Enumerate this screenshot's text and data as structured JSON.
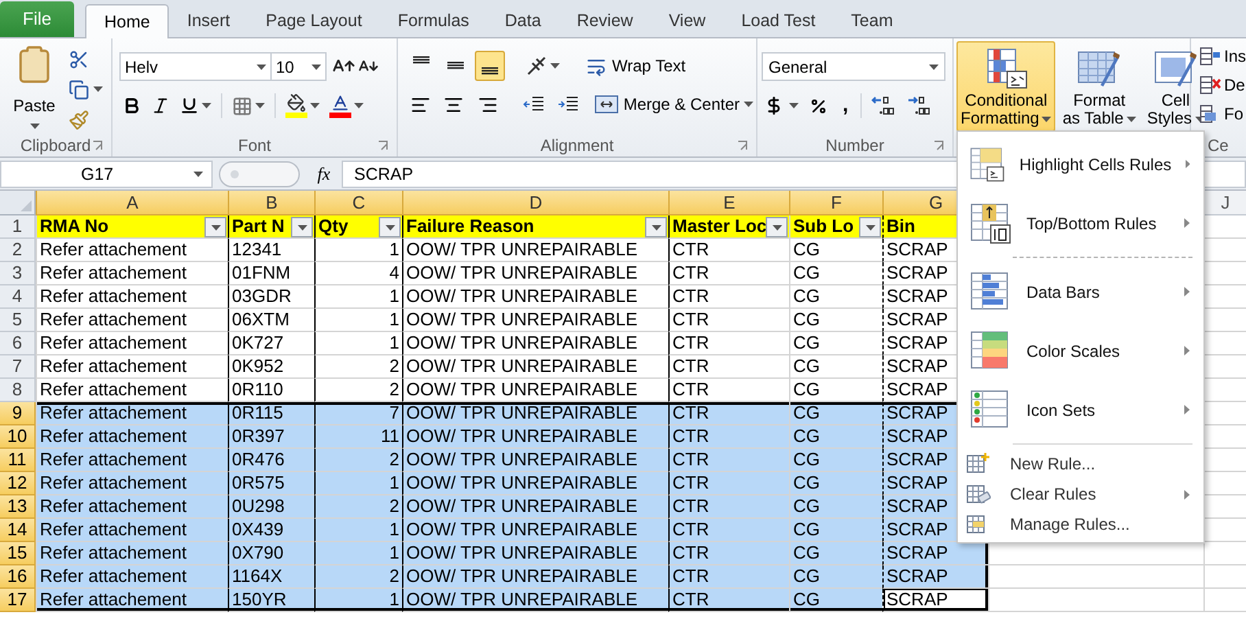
{
  "ribbon_tabs": [
    {
      "label": "File",
      "kind": "file",
      "selected": false
    },
    {
      "label": "Home",
      "kind": "tab",
      "selected": true
    },
    {
      "label": "Insert",
      "kind": "tab",
      "selected": false
    },
    {
      "label": "Page Layout",
      "kind": "tab",
      "selected": false
    },
    {
      "label": "Formulas",
      "kind": "tab",
      "selected": false
    },
    {
      "label": "Data",
      "kind": "tab",
      "selected": false
    },
    {
      "label": "Review",
      "kind": "tab",
      "selected": false
    },
    {
      "label": "View",
      "kind": "tab",
      "selected": false
    },
    {
      "label": "Load Test",
      "kind": "tab",
      "selected": false
    },
    {
      "label": "Team",
      "kind": "tab",
      "selected": false
    }
  ],
  "clipboard": {
    "paste": "Paste",
    "label": "Clipboard"
  },
  "font": {
    "name": "Helv",
    "size": "10",
    "label": "Font"
  },
  "alignment": {
    "vertical": [
      {
        "selected": false
      },
      {
        "selected": false
      },
      {
        "selected": true
      }
    ],
    "wrap_text": "Wrap Text",
    "merge_center": "Merge & Center",
    "label": "Alignment"
  },
  "number": {
    "format": "General",
    "comma": ",",
    "label": "Number"
  },
  "styles": [
    {
      "lines": [
        "Conditional",
        "Formatting"
      ],
      "selected": true
    },
    {
      "lines": [
        "Format",
        "as Table"
      ],
      "selected": false
    },
    {
      "lines": [
        "Cell",
        "Styles"
      ],
      "selected": false
    }
  ],
  "cells": {
    "items": [
      "Ins",
      "De",
      "Fo"
    ],
    "label": "Ce"
  },
  "formula_bar": {
    "name_box": "G17",
    "function_button": "fx",
    "value": "SCRAP"
  },
  "sheet": {
    "columns": [
      {
        "label": "A",
        "selected": true,
        "kind": "plain"
      },
      {
        "label": "B",
        "selected": true,
        "kind": "solid"
      },
      {
        "label": "C",
        "selected": true,
        "kind": "solid"
      },
      {
        "label": "D",
        "selected": true,
        "kind": "solid"
      },
      {
        "label": "E",
        "selected": true,
        "kind": "solid"
      },
      {
        "label": "F",
        "selected": true,
        "kind": "plain"
      },
      {
        "label": "G",
        "selected": true,
        "kind": "dashed"
      },
      {
        "label": "J",
        "selected": false,
        "kind": "plain"
      }
    ],
    "header_row": {
      "number": "1",
      "cells": [
        {
          "text": "RMA No",
          "filter": true
        },
        {
          "text": "Part N",
          "filter": true
        },
        {
          "text": "Qty",
          "filter": true
        },
        {
          "text": "Failure Reason",
          "filter": true
        },
        {
          "text": "Master Loc",
          "filter": true
        },
        {
          "text": "Sub Lo",
          "filter": true
        },
        {
          "text": "Bin"
        }
      ]
    },
    "rows": [
      {
        "number": "2",
        "selected": false,
        "active": false,
        "cells": [
          "Refer attachement",
          "12341",
          "1",
          "OOW/ TPR UNREPAIRABLE",
          "CTR",
          "CG",
          "SCRAP"
        ]
      },
      {
        "number": "3",
        "selected": false,
        "active": false,
        "cells": [
          "Refer attachement",
          "01FNM",
          "4",
          "OOW/ TPR UNREPAIRABLE",
          "CTR",
          "CG",
          "SCRAP"
        ]
      },
      {
        "number": "4",
        "selected": false,
        "active": false,
        "cells": [
          "Refer attachement",
          "03GDR",
          "1",
          "OOW/ TPR UNREPAIRABLE",
          "CTR",
          "CG",
          "SCRAP"
        ]
      },
      {
        "number": "5",
        "selected": false,
        "active": false,
        "cells": [
          "Refer attachement",
          "06XTM",
          "1",
          "OOW/ TPR UNREPAIRABLE",
          "CTR",
          "CG",
          "SCRAP"
        ]
      },
      {
        "number": "6",
        "selected": false,
        "active": false,
        "cells": [
          "Refer attachement",
          "0K727",
          "1",
          "OOW/ TPR UNREPAIRABLE",
          "CTR",
          "CG",
          "SCRAP"
        ]
      },
      {
        "number": "7",
        "selected": false,
        "active": false,
        "cells": [
          "Refer attachement",
          "0K952",
          "2",
          "OOW/ TPR UNREPAIRABLE",
          "CTR",
          "CG",
          "SCRAP"
        ]
      },
      {
        "number": "8",
        "selected": false,
        "active": false,
        "cells": [
          "Refer attachement",
          "0R110",
          "2",
          "OOW/ TPR UNREPAIRABLE",
          "CTR",
          "CG",
          "SCRAP"
        ]
      },
      {
        "number": "9",
        "selected": true,
        "active": false,
        "cells": [
          "Refer attachement",
          "0R115",
          "7",
          "OOW/ TPR UNREPAIRABLE",
          "CTR",
          "CG",
          "SCRAP"
        ]
      },
      {
        "number": "10",
        "selected": true,
        "active": false,
        "cells": [
          "Refer attachement",
          "0R397",
          "11",
          "OOW/ TPR UNREPAIRABLE",
          "CTR",
          "CG",
          "SCRAP"
        ]
      },
      {
        "number": "11",
        "selected": true,
        "active": false,
        "cells": [
          "Refer attachement",
          "0R476",
          "2",
          "OOW/ TPR UNREPAIRABLE",
          "CTR",
          "CG",
          "SCRAP"
        ]
      },
      {
        "number": "12",
        "selected": true,
        "active": false,
        "cells": [
          "Refer attachement",
          "0R575",
          "1",
          "OOW/ TPR UNREPAIRABLE",
          "CTR",
          "CG",
          "SCRAP"
        ]
      },
      {
        "number": "13",
        "selected": true,
        "active": false,
        "cells": [
          "Refer attachement",
          "0U298",
          "2",
          "OOW/ TPR UNREPAIRABLE",
          "CTR",
          "CG",
          "SCRAP"
        ]
      },
      {
        "number": "14",
        "selected": true,
        "active": false,
        "cells": [
          "Refer attachement",
          "0X439",
          "1",
          "OOW/ TPR UNREPAIRABLE",
          "CTR",
          "CG",
          "SCRAP"
        ]
      },
      {
        "number": "15",
        "selected": true,
        "active": false,
        "cells": [
          "Refer attachement",
          "0X790",
          "1",
          "OOW/ TPR UNREPAIRABLE",
          "CTR",
          "CG",
          "SCRAP"
        ]
      },
      {
        "number": "16",
        "selected": true,
        "active": false,
        "cells": [
          "Refer attachement",
          "1164X",
          "2",
          "OOW/ TPR UNREPAIRABLE",
          "CTR",
          "CG",
          "SCRAP"
        ]
      },
      {
        "number": "17",
        "selected": true,
        "active": true,
        "cells": [
          "Refer attachement",
          "150YR",
          "1",
          "OOW/ TPR UNREPAIRABLE",
          "CTR",
          "CG",
          "SCRAP"
        ]
      }
    ]
  },
  "menu": {
    "items": [
      {
        "kind": "large",
        "label": "Highlight Cells Rules",
        "submenu": true
      },
      {
        "kind": "large",
        "label": "Top/Bottom Rules",
        "submenu": true
      },
      {
        "kind": "divider",
        "dashed": true
      },
      {
        "kind": "large",
        "label": "Data Bars",
        "submenu": true
      },
      {
        "kind": "large",
        "label": "Color Scales",
        "submenu": true
      },
      {
        "kind": "large",
        "label": "Icon Sets",
        "submenu": true
      },
      {
        "kind": "divider",
        "dashed": false
      },
      {
        "kind": "small",
        "label": "New Rule...",
        "submenu": false
      },
      {
        "kind": "small",
        "label": "Clear Rules",
        "submenu": true
      },
      {
        "kind": "small",
        "label": "Manage Rules...",
        "submenu": false
      }
    ]
  }
}
